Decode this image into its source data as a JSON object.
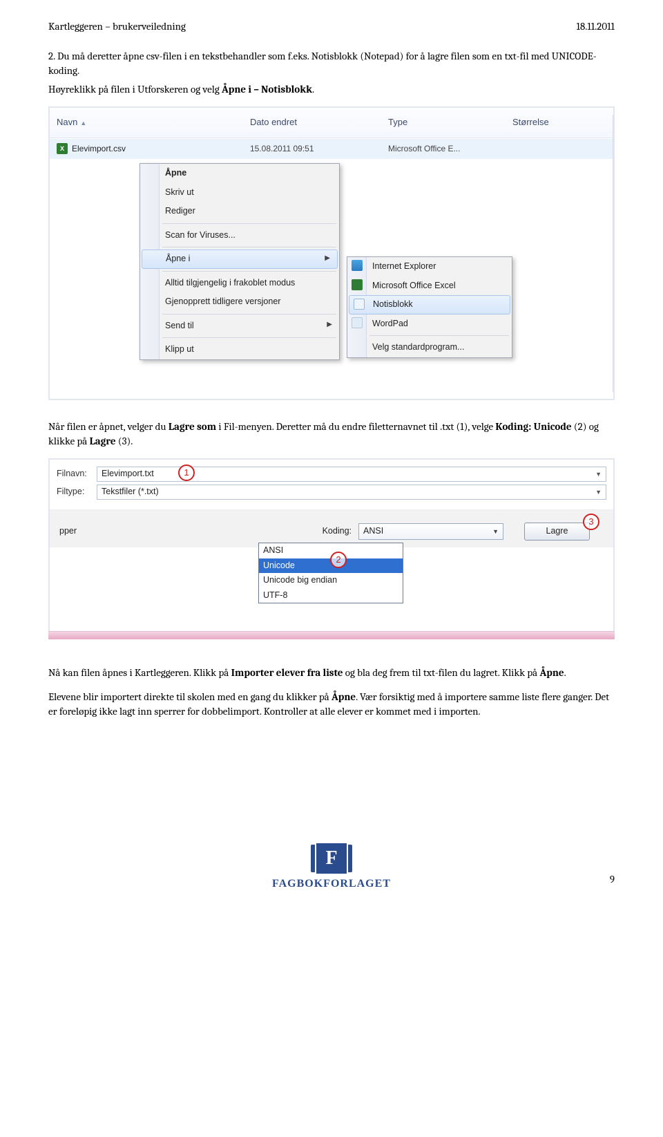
{
  "header": {
    "title": "Kartleggeren – brukerveiledning",
    "date": "18.11.2011"
  },
  "para1_a": "2. Du må deretter åpne csv-filen i en tekstbehandler som f.eks. Notisblokk (Notepad) for å lagre filen som en txt-fil med UNICODE-koding.",
  "para1_b_pre": "Høyreklikk på filen i Utforskeren og velg ",
  "para1_b_bold": "Åpne i – Notisblokk",
  "para1_b_post": ".",
  "shot1": {
    "cols": {
      "navn": "Navn",
      "dato": "Dato endret",
      "type": "Type",
      "storrelse": "Størrelse"
    },
    "row": {
      "xls": "X",
      "name": "Elevimport.csv",
      "date": "15.08.2011 09:51",
      "type": "Microsoft Office E..."
    },
    "ctx1": [
      {
        "label": "Åpne",
        "bold": true
      },
      {
        "label": "Skriv ut"
      },
      {
        "label": "Rediger"
      },
      {
        "sep": true
      },
      {
        "label": "Scan for Viruses..."
      },
      {
        "sep": true
      },
      {
        "label": "Åpne i",
        "arrow": true,
        "hover": true
      },
      {
        "sep": true
      },
      {
        "label": "Alltid tilgjengelig i frakoblet modus"
      },
      {
        "label": "Gjenopprett tidligere versjoner"
      },
      {
        "sep": true
      },
      {
        "label": "Send til",
        "arrow": true
      },
      {
        "sep": true
      },
      {
        "label": "Klipp ut"
      }
    ],
    "ctx2": [
      {
        "label": "Internet Explorer",
        "icon": "ie-ico"
      },
      {
        "label": "Microsoft Office Excel",
        "icon": "xl-ico"
      },
      {
        "label": "Notisblokk",
        "icon": "np-ico",
        "hover": true
      },
      {
        "label": "WordPad",
        "icon": "wp-ico"
      },
      {
        "sep": true
      },
      {
        "label": "Velg standardprogram..."
      }
    ]
  },
  "para2_a": "Når filen er åpnet, velger du ",
  "para2_b": "Lagre som",
  "para2_c": " i Fil-menyen. Deretter må du endre filetternavnet til .txt (1), velge ",
  "para2_d": "Koding: Unicode",
  "para2_e": " (2) og klikke på ",
  "para2_f": "Lagre",
  "para2_g": " (3).",
  "shot2": {
    "filnavn_lab": "Filnavn:",
    "filnavn_val": "Elevimport.txt",
    "filtype_lab": "Filtype:",
    "filtype_val": "Tekstfiler (*.txt)",
    "pper": "pper",
    "koding_lab": "Koding:",
    "koding_val": "ANSI",
    "lagre": "Lagre",
    "opts": [
      "ANSI",
      "Unicode",
      "Unicode big endian",
      "UTF-8"
    ],
    "c1": "1",
    "c2": "2",
    "c3": "3"
  },
  "para3_a": "Nå kan filen åpnes i Kartleggeren. Klikk på ",
  "para3_b": "Importer elever fra liste",
  "para3_c": " og bla deg frem til txt-filen du lagret. Klikk på ",
  "para3_d": "Åpne",
  "para3_e": ".",
  "para4_a": "Elevene blir importert direkte til skolen med en gang du klikker på ",
  "para4_b": "Åpne",
  "para4_c": ". Vær forsiktig med å importere samme liste flere ganger. Det er foreløpig ikke lagt inn sperrer for dobbelimport. Kontroller at alle elever er kommet med i importen.",
  "footer": {
    "logo_letter": "F",
    "logo_word": "FAGBOKFORLAGET",
    "pagenum": "9"
  }
}
